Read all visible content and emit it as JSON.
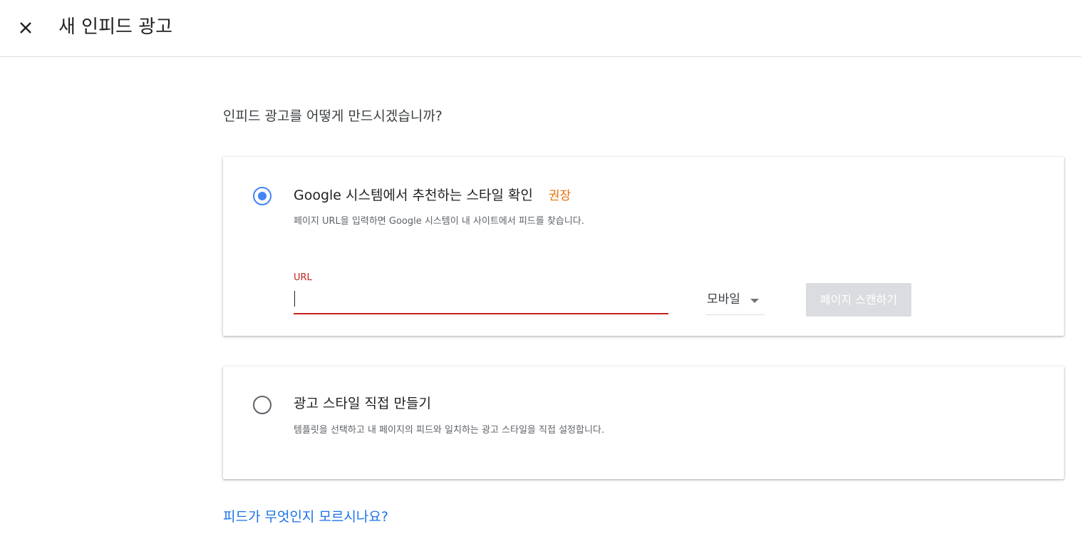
{
  "header": {
    "close_icon": "close-icon",
    "title": "새 인피드 광고"
  },
  "main": {
    "question": "인피드 광고를 어떻게 만드시겠습니까?",
    "options": [
      {
        "selected": true,
        "title": "Google 시스템에서 추천하는 스타일 확인",
        "badge": "권장",
        "description": "페이지 URL을 입력하면 Google 시스템이 내 사이트에서 피드를 찾습니다.",
        "url_field": {
          "label": "URL",
          "value": "",
          "placeholder": ""
        },
        "device_select": {
          "selected": "모바일"
        },
        "scan_button": "페이지 스캔하기"
      },
      {
        "selected": false,
        "title": "광고 스타일 직접 만들기",
        "description": "템플릿을 선택하고 내 페이지의 피드와 일치하는 광고 스타일을 직접 설정합니다."
      }
    ],
    "help_link": "피드가 무엇인지 모르시나요?"
  },
  "colors": {
    "accent": "#4285f4",
    "error": "#c5221f",
    "badge": "#e8710a",
    "link": "#1a73e8",
    "disabled_button": "#dadce0"
  }
}
